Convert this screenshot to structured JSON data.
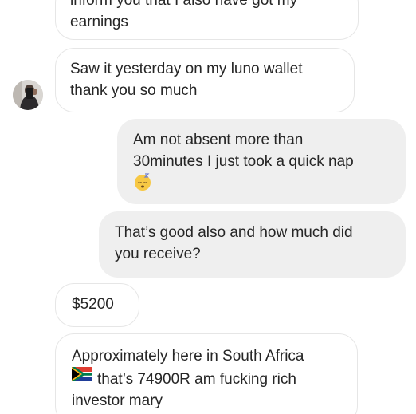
{
  "conversation": {
    "messages": [
      {
        "side": "received",
        "lines": [
          "inform you that I also have got my",
          "earnings"
        ]
      },
      {
        "side": "received",
        "lines": [
          "Saw it yesterday on my luno wallet",
          "thank you so much"
        ]
      },
      {
        "side": "sent",
        "lines": [
          "Am not absent more than",
          "30minutes I just took a quick nap"
        ],
        "emoji": "sleeping-face-icon"
      },
      {
        "side": "sent",
        "lines": [
          "That’s good also and how much did",
          "you receive?"
        ]
      },
      {
        "side": "received",
        "lines": [
          "$5200"
        ]
      },
      {
        "side": "received",
        "lines": [
          "Approximately here in South Africa",
          "that’s 74900R am fucking rich",
          "investor mary"
        ],
        "flag": "south-africa-flag-icon"
      }
    ]
  },
  "colors": {
    "received_bubble_bg": "#ffffff",
    "received_bubble_border": "#e6e6e6",
    "sent_bubble_bg": "#efefef",
    "text": "#262626"
  }
}
